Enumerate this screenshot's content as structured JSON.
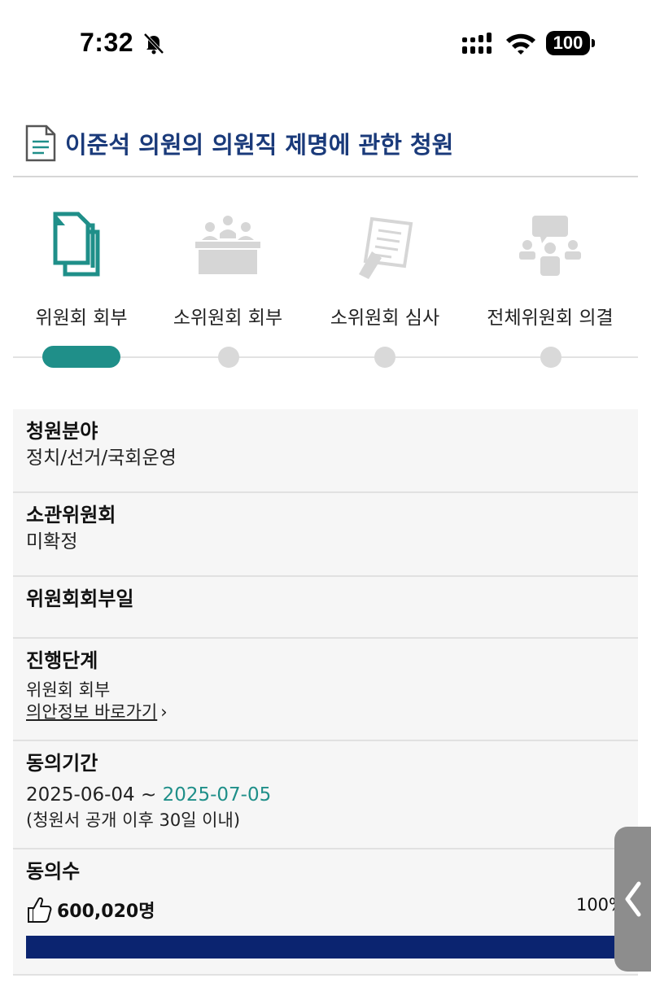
{
  "status_bar": {
    "time": "7:32",
    "battery": "100",
    "icons": [
      "bell-slash-icon",
      "signal-icon",
      "wifi-icon",
      "battery-icon"
    ]
  },
  "title": "이준석 의원의 의원직 제명에 관한 청원",
  "steps": [
    {
      "label": "위원회 회부",
      "icon": "documents-icon",
      "active": true
    },
    {
      "label": "소위원회 회부",
      "icon": "meeting-icon",
      "active": false
    },
    {
      "label": "소위원회 심사",
      "icon": "review-icon",
      "active": false
    },
    {
      "label": "전체위원회 의결",
      "icon": "presentation-icon",
      "active": false
    }
  ],
  "info": {
    "field": {
      "label": "청원분야",
      "value": "정치/선거/국회운영"
    },
    "committee": {
      "label": "소관위원회",
      "value": "미확정"
    },
    "referral_date": {
      "label": "위원회회부일",
      "value": ""
    },
    "stage": {
      "label": "진행단계",
      "value": "위원회 회부",
      "link": "의안정보 바로가기",
      "link_chevron": "›"
    },
    "period": {
      "label": "동의기간",
      "start": "2025-06-04",
      "separator": " ~ ",
      "end": "2025-07-05",
      "note": "(청원서 공개 이후 30일 이내)"
    },
    "agree": {
      "label": "동의수",
      "count": "600,020명",
      "percent": "100%",
      "progress": 1.0
    }
  },
  "colors": {
    "title": "#1a3a7a",
    "accent": "#1f8f89",
    "progress": "#0b2470",
    "inactive": "#d9d9d9"
  }
}
